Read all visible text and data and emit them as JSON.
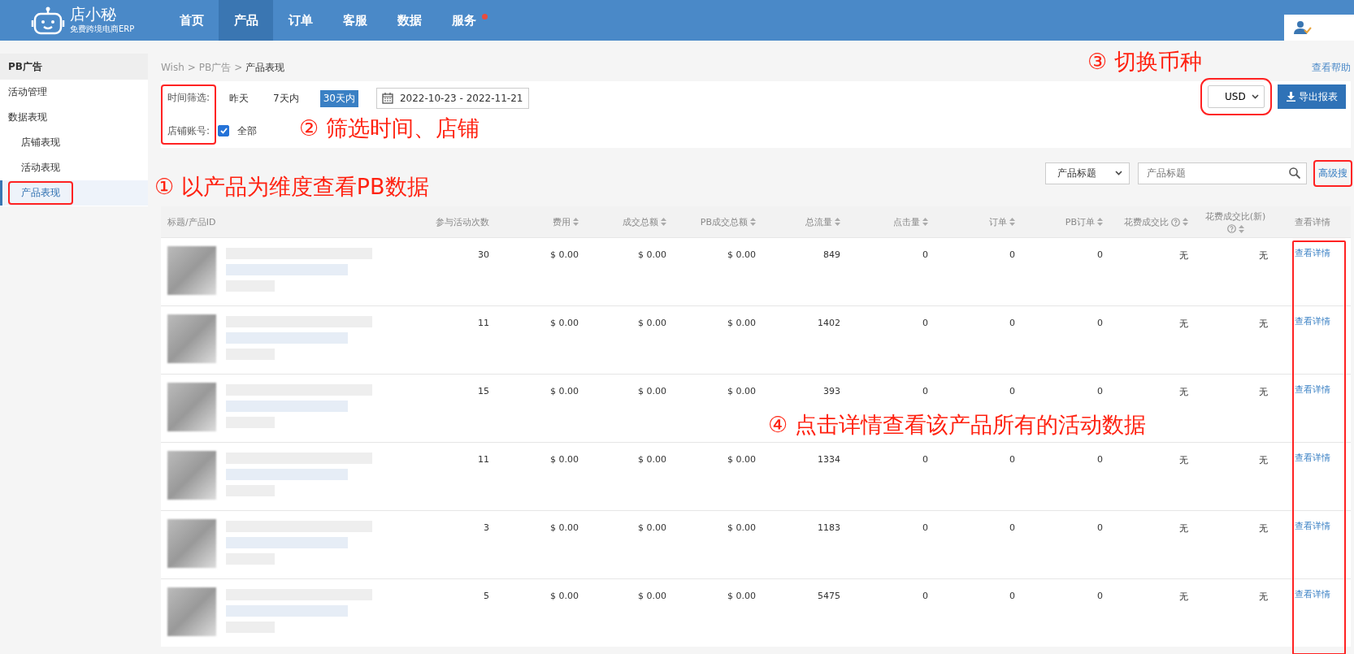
{
  "header": {
    "logo_title": "店小秘",
    "logo_subtitle": "免费跨境电商ERP",
    "nav": [
      {
        "label": "首页",
        "selected": false,
        "badge": false
      },
      {
        "label": "产品",
        "selected": true,
        "badge": false
      },
      {
        "label": "订单",
        "selected": false,
        "badge": false
      },
      {
        "label": "客服",
        "selected": false,
        "badge": false
      },
      {
        "label": "数据",
        "selected": false,
        "badge": false
      },
      {
        "label": "服务",
        "selected": false,
        "badge": true
      }
    ]
  },
  "sidebar": {
    "title": "PB广告",
    "items": [
      {
        "label": "活动管理",
        "selected": false,
        "annotated": false
      },
      {
        "label": "数据表现",
        "selected": false,
        "annotated": false,
        "children": [
          {
            "label": "店铺表现",
            "selected": false,
            "annotated": false
          },
          {
            "label": "活动表现",
            "selected": false,
            "annotated": false
          },
          {
            "label": "产品表现",
            "selected": true,
            "annotated": true
          }
        ]
      }
    ]
  },
  "breadcrumb": {
    "separator": ">",
    "items": [
      "Wish",
      "PB广告",
      "产品表现"
    ]
  },
  "help_link": "查看帮助",
  "filters": {
    "labels_annotated": true,
    "time_label": "时间筛选:",
    "time_options": [
      {
        "label": "昨天",
        "selected": false
      },
      {
        "label": "7天内",
        "selected": false
      },
      {
        "label": "30天内",
        "selected": true
      }
    ],
    "date_range": "2022-10-23 - 2022-11-21",
    "store_label": "店铺账号:",
    "store_all": {
      "label": "全部",
      "checked": true
    }
  },
  "currency": {
    "value": "USD",
    "annotated": true
  },
  "export_button": "导出报表",
  "search": {
    "field_select": "产品标题",
    "placeholder": "产品标题",
    "advanced_link": "高级搜",
    "advanced_annotated": true
  },
  "table": {
    "detail_annotated": true,
    "columns": [
      {
        "label": "标题/产品ID",
        "sortable": false,
        "help": false
      },
      {
        "label": "参与活动次数",
        "sortable": false,
        "help": false
      },
      {
        "label": "费用",
        "sortable": true,
        "help": false
      },
      {
        "label": "成交总额",
        "sortable": true,
        "help": false
      },
      {
        "label": "PB成交总额",
        "sortable": true,
        "help": false
      },
      {
        "label": "总流量",
        "sortable": true,
        "help": false
      },
      {
        "label": "点击量",
        "sortable": true,
        "help": false
      },
      {
        "label": "订单",
        "sortable": true,
        "help": false
      },
      {
        "label": "PB订单",
        "sortable": true,
        "help": false
      },
      {
        "label": "花费成交比",
        "sortable": true,
        "help": true
      },
      {
        "label": "花费成交比(新)",
        "sortable": true,
        "help": true
      },
      {
        "label": "查看详情",
        "sortable": false,
        "help": false
      }
    ],
    "rows": [
      {
        "cells": [
          "",
          "30",
          "$ 0.00",
          "$ 0.00",
          "$ 0.00",
          "849",
          "0",
          "0",
          "0",
          "无",
          "无"
        ],
        "action": "查看详情"
      },
      {
        "cells": [
          "",
          "11",
          "$ 0.00",
          "$ 0.00",
          "$ 0.00",
          "1402",
          "0",
          "0",
          "0",
          "无",
          "无"
        ],
        "action": "查看详情"
      },
      {
        "cells": [
          "",
          "15",
          "$ 0.00",
          "$ 0.00",
          "$ 0.00",
          "393",
          "0",
          "0",
          "0",
          "无",
          "无"
        ],
        "action": "查看详情"
      },
      {
        "cells": [
          "",
          "11",
          "$ 0.00",
          "$ 0.00",
          "$ 0.00",
          "1334",
          "0",
          "0",
          "0",
          "无",
          "无"
        ],
        "action": "查看详情"
      },
      {
        "cells": [
          "",
          "3",
          "$ 0.00",
          "$ 0.00",
          "$ 0.00",
          "1183",
          "0",
          "0",
          "0",
          "无",
          "无"
        ],
        "action": "查看详情"
      },
      {
        "cells": [
          "",
          "5",
          "$ 0.00",
          "$ 0.00",
          "$ 0.00",
          "5475",
          "0",
          "0",
          "0",
          "无",
          "无"
        ],
        "action": "查看详情"
      }
    ]
  },
  "annotations": [
    {
      "text": "③ 切换币种"
    },
    {
      "text": "② 筛选时间、店铺"
    },
    {
      "text": "① 以产品为维度查看PB数据"
    },
    {
      "text": "④ 点击详情查看该产品所有的活动数据"
    }
  ]
}
